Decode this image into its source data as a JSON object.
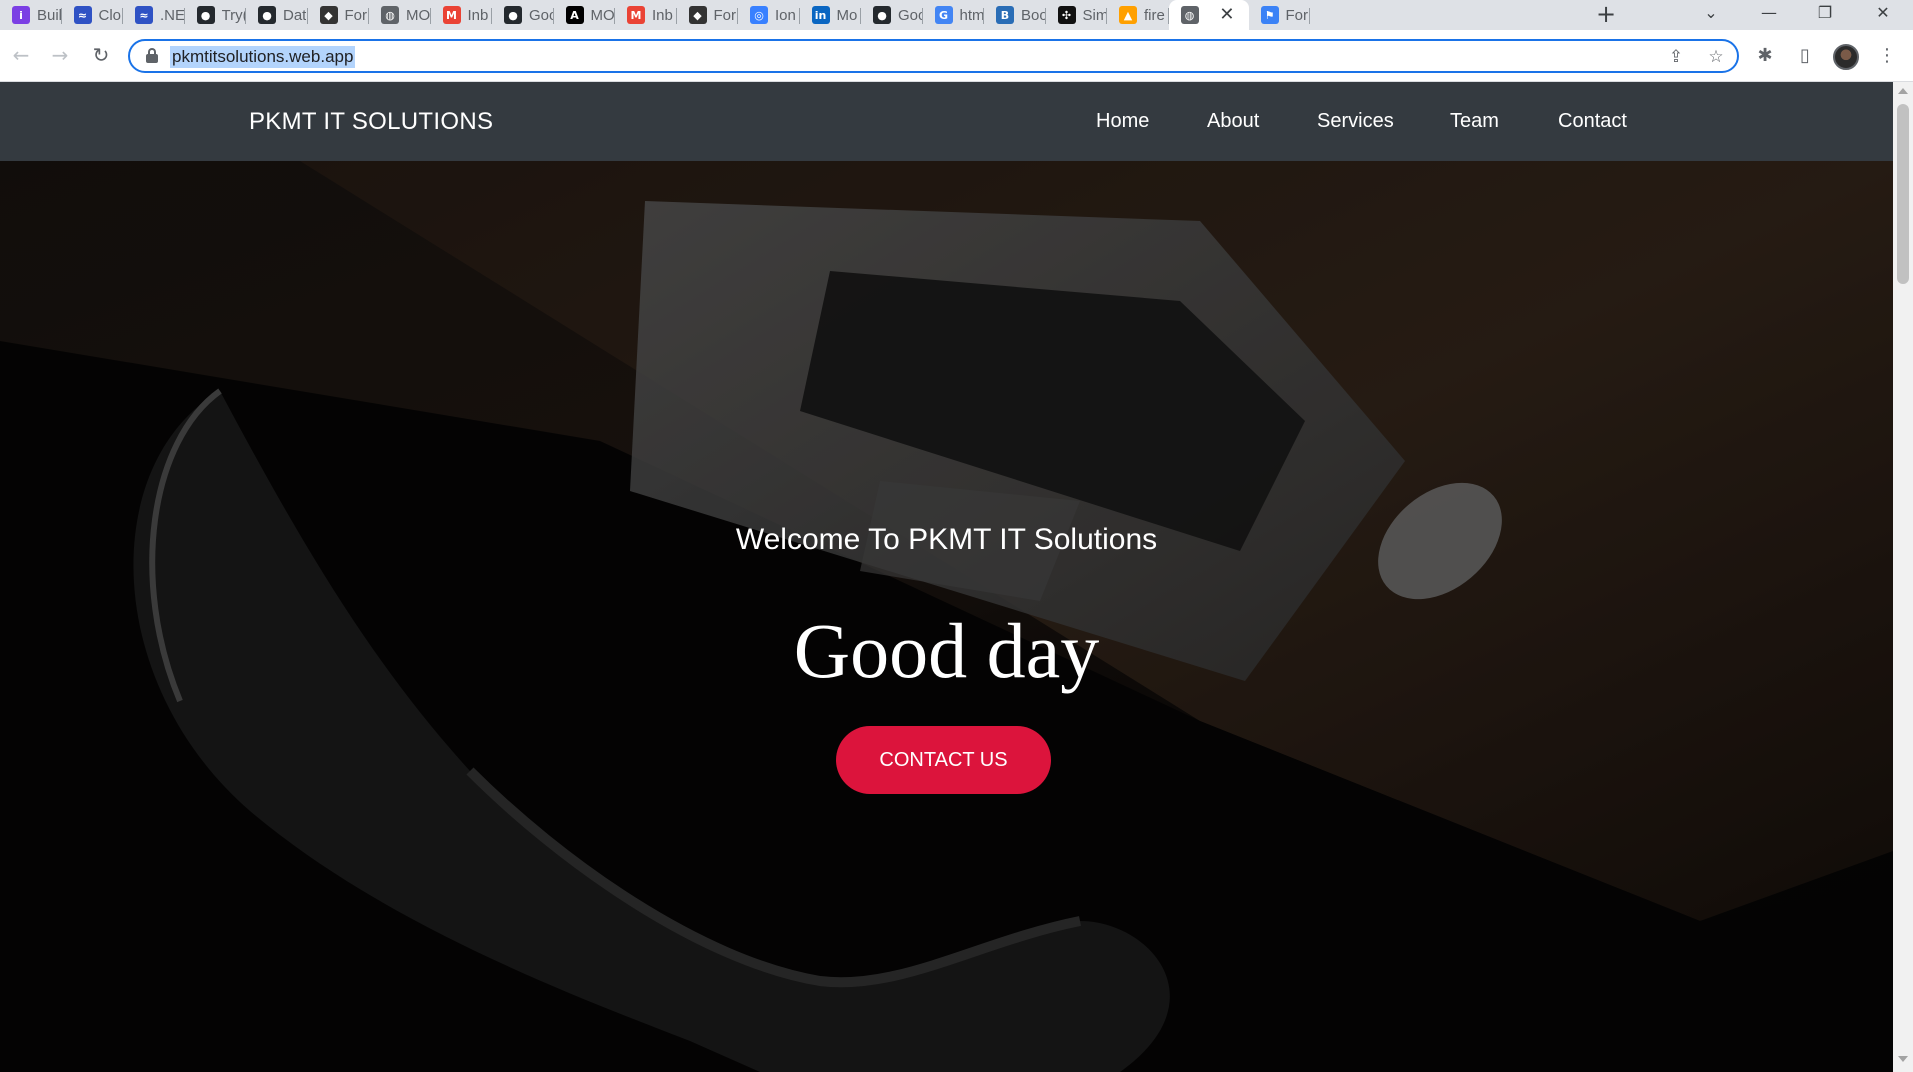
{
  "browser": {
    "tabs": [
      {
        "title": "Buil",
        "icon": "purple-circle-icon",
        "color": "#7b3fe4"
      },
      {
        "title": "Clo",
        "icon": "cloud-app-icon",
        "color": "#2f52c4"
      },
      {
        "title": ".NE",
        "icon": "cloud-app-icon",
        "color": "#2f52c4"
      },
      {
        "title": "Try(",
        "icon": "github-icon",
        "color": "#24292e"
      },
      {
        "title": "Dat",
        "icon": "github-icon",
        "color": "#24292e"
      },
      {
        "title": "For",
        "icon": "forum-icon",
        "color": "#333333"
      },
      {
        "title": "MO",
        "icon": "globe-icon",
        "color": "#5f6368"
      },
      {
        "title": "Inb",
        "icon": "gmail-icon",
        "color": "#ea4335"
      },
      {
        "title": "Goo",
        "icon": "github-icon",
        "color": "#24292e"
      },
      {
        "title": "MO",
        "icon": "angular-icon",
        "color": "#000000"
      },
      {
        "title": "Inb",
        "icon": "gmail-icon",
        "color": "#ea4335"
      },
      {
        "title": "For",
        "icon": "forum-icon",
        "color": "#333333"
      },
      {
        "title": "Ion",
        "icon": "ionic-icon",
        "color": "#3880ff"
      },
      {
        "title": "Mo",
        "icon": "linkedin-icon",
        "color": "#0a66c2"
      },
      {
        "title": "Goo",
        "icon": "github-icon",
        "color": "#24292e"
      },
      {
        "title": "htm",
        "icon": "google-icon",
        "color": "#4285f4"
      },
      {
        "title": "Boo",
        "icon": "bootstrap-icon",
        "color": "#2a6db6"
      },
      {
        "title": "Sim",
        "icon": "openai-icon",
        "color": "#111111"
      },
      {
        "title": "fire",
        "icon": "firebase-icon",
        "color": "#ffa000"
      },
      {
        "title": "",
        "icon": "globe-icon",
        "color": "#5f6368",
        "active": true
      },
      {
        "title": "For",
        "icon": "flag-icon",
        "color": "#3b82f6"
      }
    ],
    "url": "pkmtitsolutions.web.app"
  },
  "site": {
    "brand": "PKMT IT SOLUTIONS",
    "nav": [
      "Home",
      "About",
      "Services",
      "Team",
      "Contact"
    ],
    "hero": {
      "welcome": "Welcome To PKMT IT Solutions",
      "greeting": "Good day",
      "cta": "CONTACT US"
    }
  },
  "colors": {
    "navbar": "#343a40",
    "cta": "#dc143c",
    "omnibox_focus": "#1a73e8"
  }
}
